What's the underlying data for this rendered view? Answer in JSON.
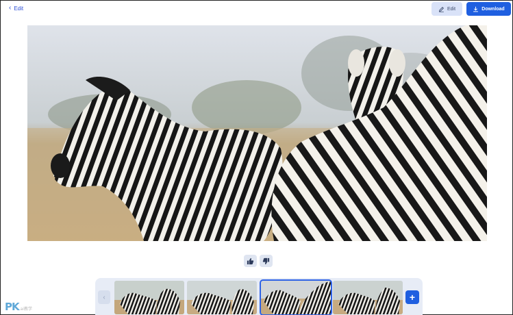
{
  "header": {
    "back_label": "Edit",
    "edit_label": "Edit",
    "download_label": "Download"
  },
  "main_image": {
    "subject": "zebras on savanna"
  },
  "feedback": {
    "like_icon": "thumbs-up-icon",
    "dislike_icon": "thumbs-down-icon"
  },
  "strip": {
    "prev_icon": "chevron-left-icon",
    "add_icon": "plus-icon",
    "selected_index": 2,
    "thumbnails": [
      {
        "subject": "zebras"
      },
      {
        "subject": "zebras"
      },
      {
        "subject": "zebras"
      },
      {
        "subject": "zebras"
      }
    ]
  },
  "watermark": {
    "logo": "PK",
    "tagline": "ai教学"
  },
  "colors": {
    "accent": "#1f5fe0",
    "light_accent": "#d9e2f8",
    "strip_bg": "#e7ecf6"
  }
}
